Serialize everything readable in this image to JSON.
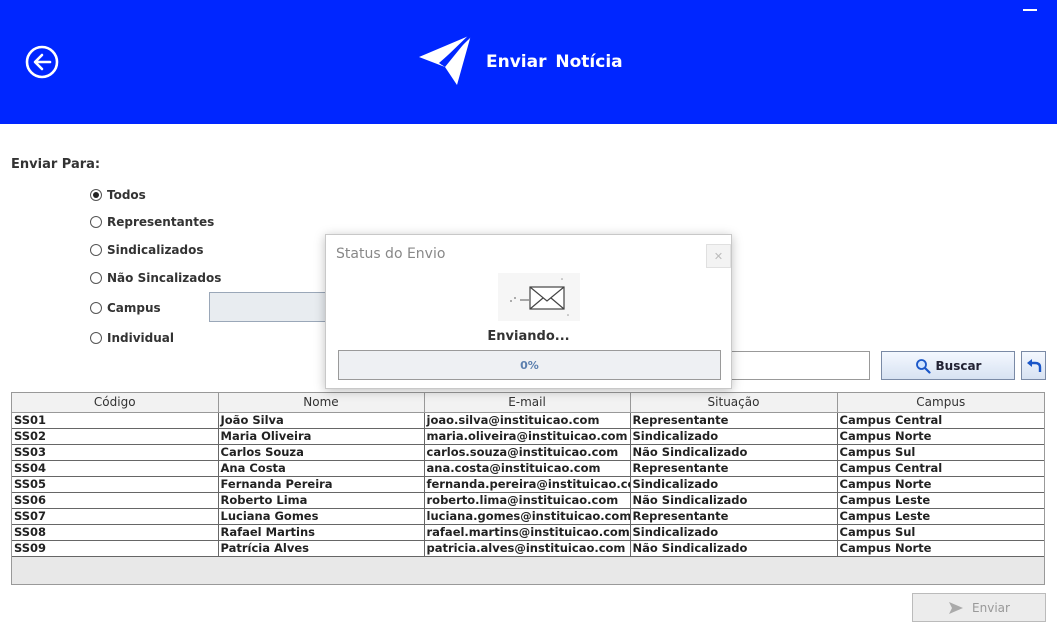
{
  "header": {
    "title": "Enviar  Notícia",
    "back_icon": "back-arrow-circle-icon",
    "logo_icon": "paper-plane-icon",
    "accent": "#0026ff"
  },
  "form": {
    "enviar_para_label": "Enviar Para:",
    "options": [
      {
        "label": "Todos",
        "checked": true
      },
      {
        "label": "Representantes",
        "checked": false
      },
      {
        "label": "Sindicalizados",
        "checked": false
      },
      {
        "label": "Não Sincalizados",
        "checked": false
      },
      {
        "label": "Campus",
        "checked": false
      },
      {
        "label": "Individual",
        "checked": false
      }
    ],
    "search_value": "",
    "buscar_label": "Buscar",
    "enviar_label": "Enviar"
  },
  "table": {
    "columns": [
      "Código",
      "Nome",
      "E-mail",
      "Situação",
      "Campus"
    ],
    "rows": [
      [
        "SS01",
        "João Silva",
        "joao.silva@instituicao.com",
        "Representante",
        "Campus Central"
      ],
      [
        "SS02",
        "Maria Oliveira",
        "maria.oliveira@instituicao.com",
        "Sindicalizado",
        "Campus Norte"
      ],
      [
        "SS03",
        "Carlos Souza",
        "carlos.souza@instituicao.com",
        "Não Sindicalizado",
        "Campus Sul"
      ],
      [
        "SS04",
        "Ana Costa",
        "ana.costa@instituicao.com",
        "Representante",
        "Campus Central"
      ],
      [
        "SS05",
        "Fernanda Pereira",
        "fernanda.pereira@instituicao.com",
        "Sindicalizado",
        "Campus Norte"
      ],
      [
        "SS06",
        "Roberto Lima",
        "roberto.lima@instituicao.com",
        "Não Sindicalizado",
        "Campus Leste"
      ],
      [
        "SS07",
        "Luciana Gomes",
        "luciana.gomes@instituicao.com",
        "Representante",
        "Campus Leste"
      ],
      [
        "SS08",
        "Rafael Martins",
        "rafael.martins@instituicao.com",
        "Sindicalizado",
        "Campus Sul"
      ],
      [
        "SS09",
        "Patrícia Alves",
        "patricia.alves@instituicao.com",
        "Não Sindicalizado",
        "Campus Norte"
      ]
    ]
  },
  "dialog": {
    "title": "Status do Envio",
    "status": "Enviando...",
    "progress_text": "0%",
    "progress_fraction": 0
  }
}
